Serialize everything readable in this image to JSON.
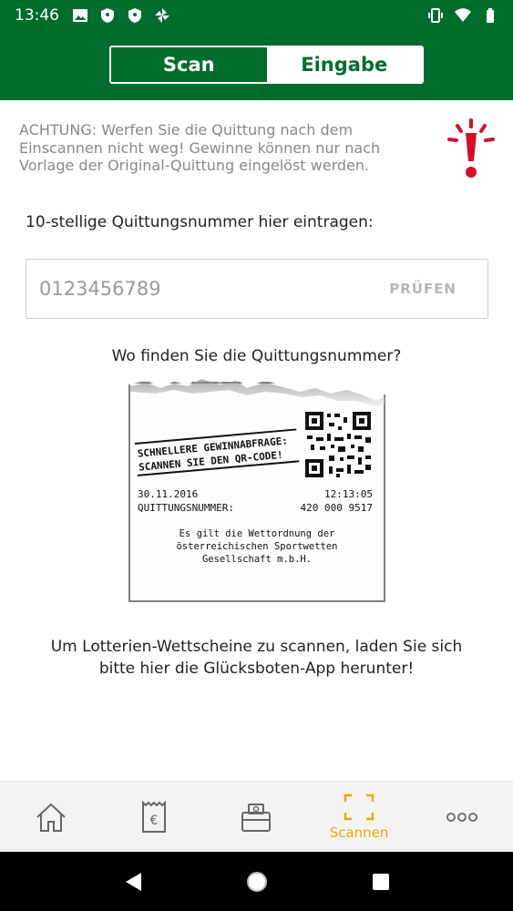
{
  "status_bar": {
    "time": "13:46",
    "left_icons": [
      "image-icon",
      "shield-icon",
      "shield-icon",
      "pinwheel-icon"
    ],
    "right_icons": [
      "vibrate-icon",
      "wifi-icon",
      "battery-icon"
    ]
  },
  "tabs": [
    {
      "label": "Scan",
      "active": true
    },
    {
      "label": "Eingabe",
      "active": false
    }
  ],
  "warning": {
    "text": "ACHTUNG: Werfen Sie die Quittung nach dem Einscannen nicht weg! Gewinne können nur nach Vorlage der Original-Quittung eingelöst werden.",
    "icon": "alert-exclamation-icon",
    "icon_color": "#d3102a"
  },
  "receipt_input": {
    "label": "10-stellige Quittungsnummer hier eintragen:",
    "placeholder": "0123456789",
    "value": "",
    "check_label": "PRÜFEN"
  },
  "help": {
    "title": "Wo finden Sie die Quittungsnummer?",
    "receipt": {
      "headline_line1": "SCHNELLERE GEWINNABFRAGE:",
      "headline_line2": "SCANNEN SIE DEN QR-CODE!",
      "date": "30.11.2016",
      "time": "12:13:05",
      "number_label": "QUITTUNGSNUMMER:",
      "number": "420 000 9517",
      "footer_line1": "Es gilt die Wettordnung der",
      "footer_line2": "österreichischen Sportwetten",
      "footer_line3": "Gesellschaft m.b.H."
    }
  },
  "lottery_note": {
    "line1": "Um Lotterien-Wettscheine zu scannen, laden Sie sich",
    "line2": "bitte hier die Glücksboten-App herunter!"
  },
  "bottom_nav": {
    "items": [
      {
        "icon": "home-icon",
        "label": ""
      },
      {
        "icon": "euro-receipt-icon",
        "label": ""
      },
      {
        "icon": "wallet-icon",
        "label": ""
      },
      {
        "icon": "scan-frame-icon",
        "label": "Scannen",
        "active": true
      },
      {
        "icon": "more-icon",
        "label": ""
      }
    ],
    "active_color": "#e8a900"
  },
  "colors": {
    "brand_green": "#006d2c",
    "accent_yellow": "#e8a900"
  }
}
